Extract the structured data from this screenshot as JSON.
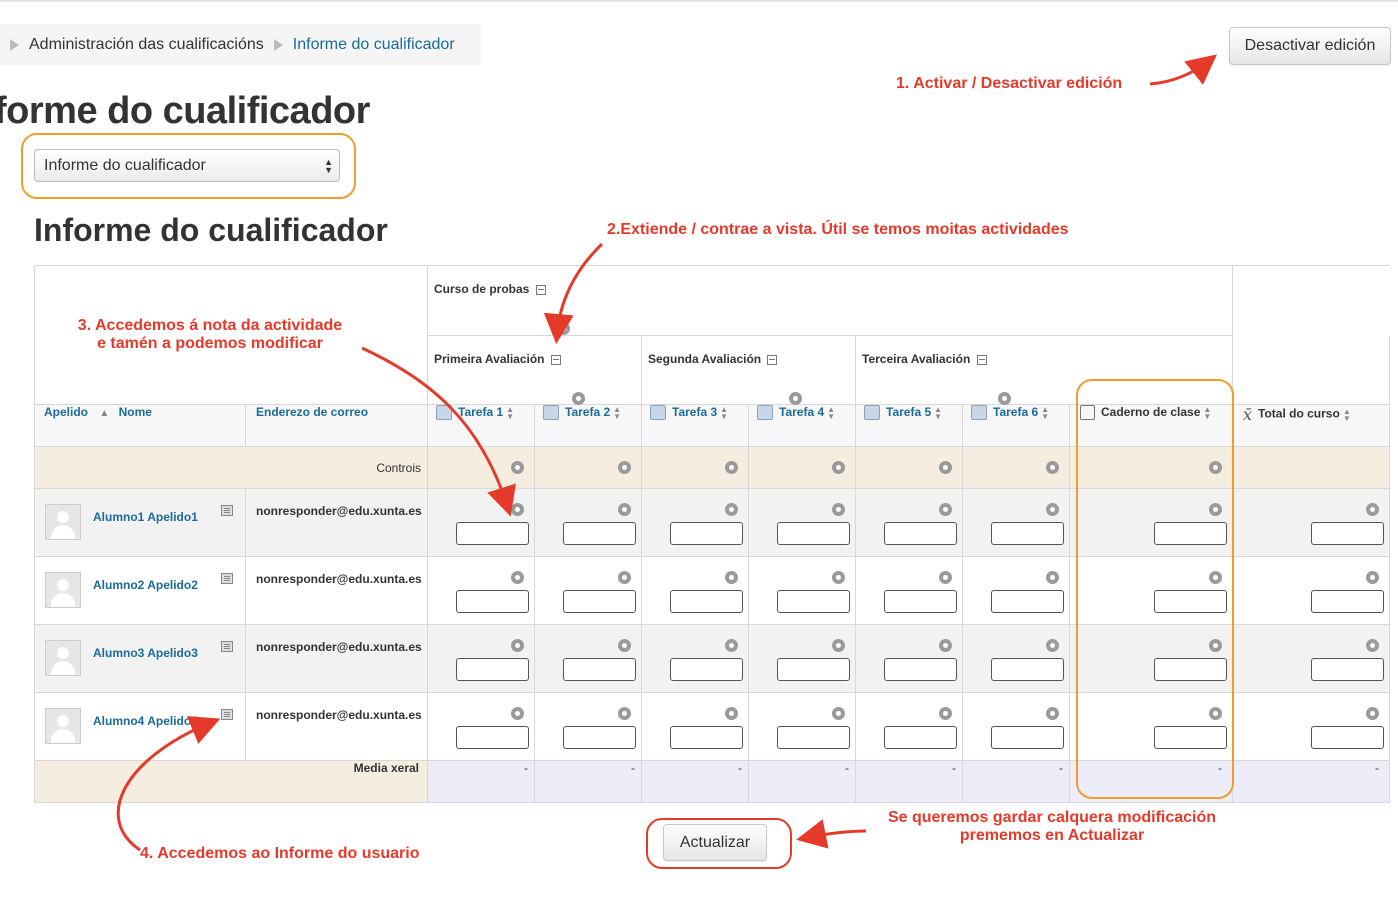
{
  "breadcrumb": {
    "items": [
      "Administración das cualificacións",
      "Informe do cualificador"
    ]
  },
  "edit_button": "Desactivar edición",
  "page_title": "forme do cualificador",
  "report_select": {
    "value": "Informe do cualificador"
  },
  "section_title": "Informe do cualificador",
  "categories": {
    "course": "Curso de probas",
    "first": "Primeira Avaliación",
    "second": "Segunda Avaliación",
    "third": "Terceira Avaliación"
  },
  "headers": {
    "surname": "Apelido",
    "name": "Nome",
    "email": "Enderezo de correo",
    "items": [
      "Tarefa 1",
      "Tarefa 2",
      "Tarefa 3",
      "Tarefa 4",
      "Tarefa 5",
      "Tarefa 6"
    ],
    "notebook": "Caderno de clase",
    "total": "Total do curso"
  },
  "controls_label": "Controis",
  "students": [
    {
      "name": "Alumno1 Apelido1",
      "email": "nonresponder@edu.xunta.es"
    },
    {
      "name": "Alumno2 Apelido2",
      "email": "nonresponder@edu.xunta.es"
    },
    {
      "name": "Alumno3 Apelido3",
      "email": "nonresponder@edu.xunta.es"
    },
    {
      "name": "Alumno4 Apelido4",
      "email": "nonresponder@edu.xunta.es"
    }
  ],
  "average": {
    "label": "Media xeral",
    "values": [
      "-",
      "-",
      "-",
      "-",
      "-",
      "-",
      "-",
      "-"
    ]
  },
  "update_button": "Actualizar",
  "annotations": {
    "a1": "1. Activar / Desactivar edición",
    "a2": "2.Extiende / contrae a vista. Útil se temos moitas actividades",
    "a3_line1": "3. Accedemos á nota da actividade",
    "a3_line2": "e tamén a podemos modificar",
    "a4": "4. Accedemos ao Informe do usuario",
    "a5_line1": "Se queremos gardar calquera modificación",
    "a5_line2": "prememos en Actualizar"
  },
  "colors": {
    "annotation": "#e53a2a",
    "highlight_orange": "#f39c2b",
    "link": "#1a6b9a"
  }
}
